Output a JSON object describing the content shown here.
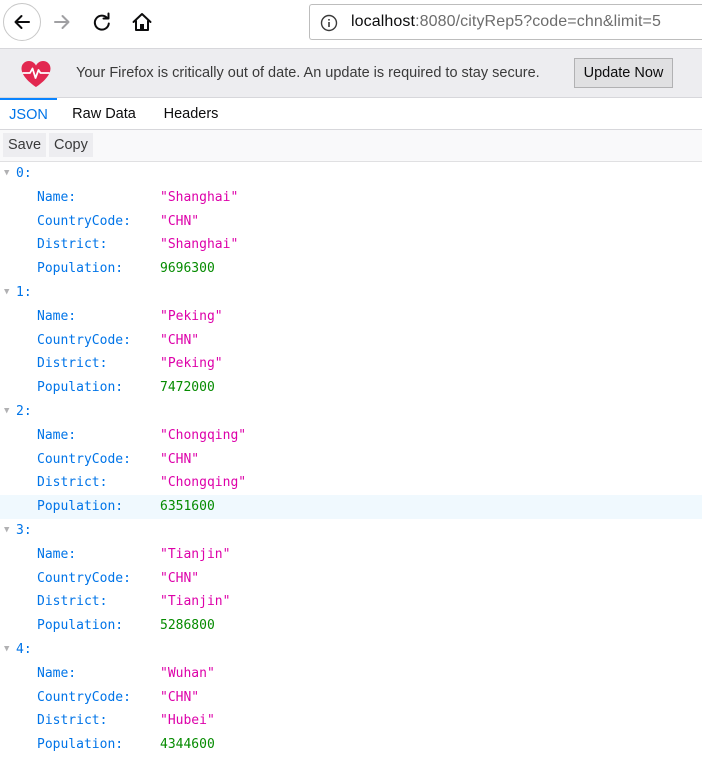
{
  "toolbar": {
    "url_host": "localhost",
    "url_rest": ":8080/cityRep5?code=chn&limit=5"
  },
  "notification": {
    "message": "Your Firefox is critically out of date. An update is required to stay secure.",
    "button_label": "Update Now"
  },
  "tabs": [
    {
      "label": "JSON",
      "active": true
    },
    {
      "label": "Raw Data",
      "active": false
    },
    {
      "label": "Headers",
      "active": false
    }
  ],
  "actions": {
    "save_label": "Save",
    "copy_label": "Copy"
  },
  "field_labels": {
    "name": "Name:",
    "country_code": "CountryCode:",
    "district": "District:",
    "population": "Population:"
  },
  "records": [
    {
      "index": "0:",
      "name": "\"Shanghai\"",
      "country_code": "\"CHN\"",
      "district": "\"Shanghai\"",
      "population": "9696300"
    },
    {
      "index": "1:",
      "name": "\"Peking\"",
      "country_code": "\"CHN\"",
      "district": "\"Peking\"",
      "population": "7472000"
    },
    {
      "index": "2:",
      "name": "\"Chongqing\"",
      "country_code": "\"CHN\"",
      "district": "\"Chongqing\"",
      "population": "6351600"
    },
    {
      "index": "3:",
      "name": "\"Tianjin\"",
      "country_code": "\"CHN\"",
      "district": "\"Tianjin\"",
      "population": "5286800"
    },
    {
      "index": "4:",
      "name": "\"Wuhan\"",
      "country_code": "\"CHN\"",
      "district": "\"Hubei\"",
      "population": "4344600"
    }
  ],
  "colors": {
    "key": "#0074e8",
    "string": "#dd00a9",
    "number": "#058b00",
    "highlight_row": "#f0f9fe",
    "heart": "#e22850"
  },
  "icons": [
    "back-arrow-icon",
    "forward-arrow-icon",
    "reload-icon",
    "home-icon",
    "info-icon",
    "heart-pulse-icon",
    "twisty-down-icon"
  ]
}
